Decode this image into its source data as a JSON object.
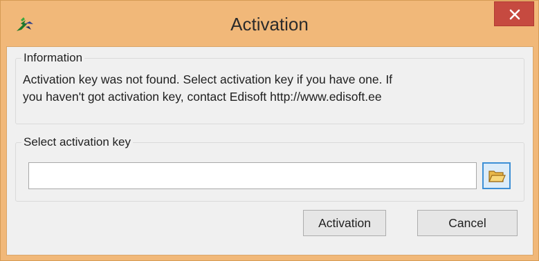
{
  "window": {
    "title": "Activation",
    "app_icon": "edisoft-logo-icon",
    "close_icon": "close-icon",
    "close_button_color": "#c64a40",
    "titlebar_color": "#f1b879"
  },
  "information": {
    "legend": "Information",
    "text": "Activation key was not found. Select activation key if you have one. If\nyou haven't got activation key, contact Edisoft http://www.edisoft.ee"
  },
  "key_selection": {
    "legend": "Select activation key",
    "input_value": "",
    "browse_icon": "folder-open-icon"
  },
  "buttons": {
    "activation_label": "Activation",
    "cancel_label": "Cancel"
  }
}
